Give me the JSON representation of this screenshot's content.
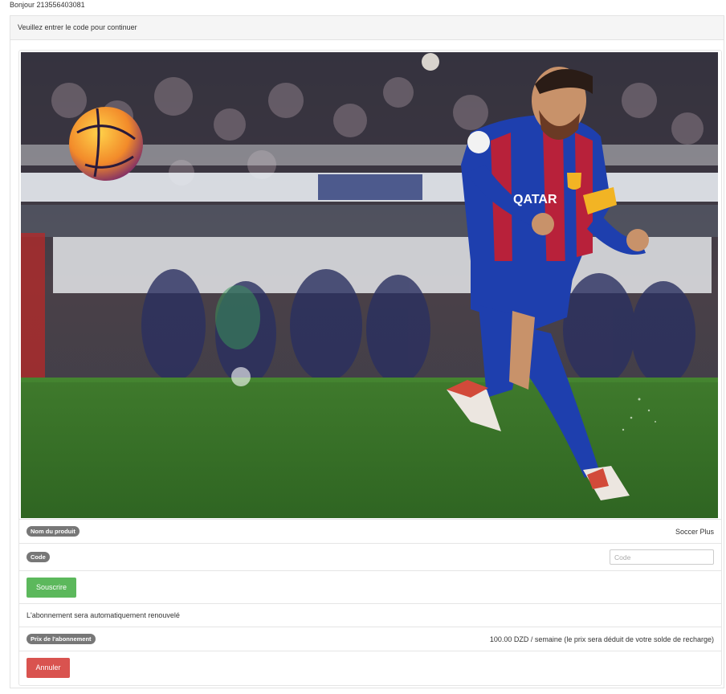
{
  "greeting": "Bonjour 213556403081",
  "panel": {
    "heading": "Veuillez entrer le code pour continuer"
  },
  "photo": {
    "subject": "soccer-player-kicking-ball",
    "jersey_text": "QATAR"
  },
  "product": {
    "label": "Nom du produit",
    "value": "Soccer Plus"
  },
  "code": {
    "label": "Code",
    "placeholder": "Code",
    "value": ""
  },
  "subscribe_button": "Souscrire",
  "renewal_notice": "L'abonnement sera automatiquement renouvelé",
  "price": {
    "label": "Prix de l'abonnement",
    "value": "100.00 DZD / semaine (le prix sera déduit de votre solde de recharge)"
  },
  "cancel_button": "Annuler",
  "colors": {
    "success": "#5cb85c",
    "danger": "#d9534f",
    "badge": "#777777",
    "panel_heading_bg": "#f5f5f5"
  }
}
